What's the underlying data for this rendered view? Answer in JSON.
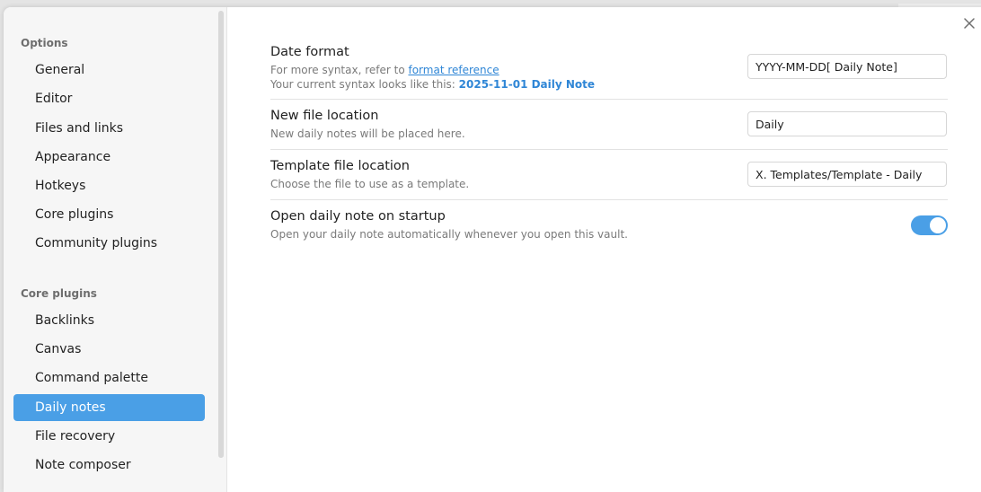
{
  "sidebar": {
    "sections": [
      {
        "heading": "Options",
        "items": [
          "General",
          "Editor",
          "Files and links",
          "Appearance",
          "Hotkeys",
          "Core plugins",
          "Community plugins"
        ]
      },
      {
        "heading": "Core plugins",
        "items": [
          "Backlinks",
          "Canvas",
          "Command palette",
          "Daily notes",
          "File recovery",
          "Note composer"
        ]
      }
    ],
    "active_item": "Daily notes"
  },
  "settings": {
    "date_format": {
      "name": "Date format",
      "desc_prefix": "For more syntax, refer to ",
      "desc_link": "format reference",
      "desc_current_prefix": "Your current syntax looks like this: ",
      "desc_current_value": "2025-11-01 Daily Note",
      "value": "YYYY-MM-DD[ Daily Note]"
    },
    "new_file_location": {
      "name": "New file location",
      "desc": "New daily notes will be placed here.",
      "value": "Daily"
    },
    "template_file_location": {
      "name": "Template file location",
      "desc": "Choose the file to use as a template.",
      "value": "X. Templates/Template - Daily"
    },
    "open_on_startup": {
      "name": "Open daily note on startup",
      "desc": "Open your daily note automatically whenever you open this vault.",
      "enabled": true
    }
  },
  "colors": {
    "accent": "#4a9fe6",
    "link": "#2f86d6"
  },
  "icons": {
    "close": "close-icon"
  }
}
